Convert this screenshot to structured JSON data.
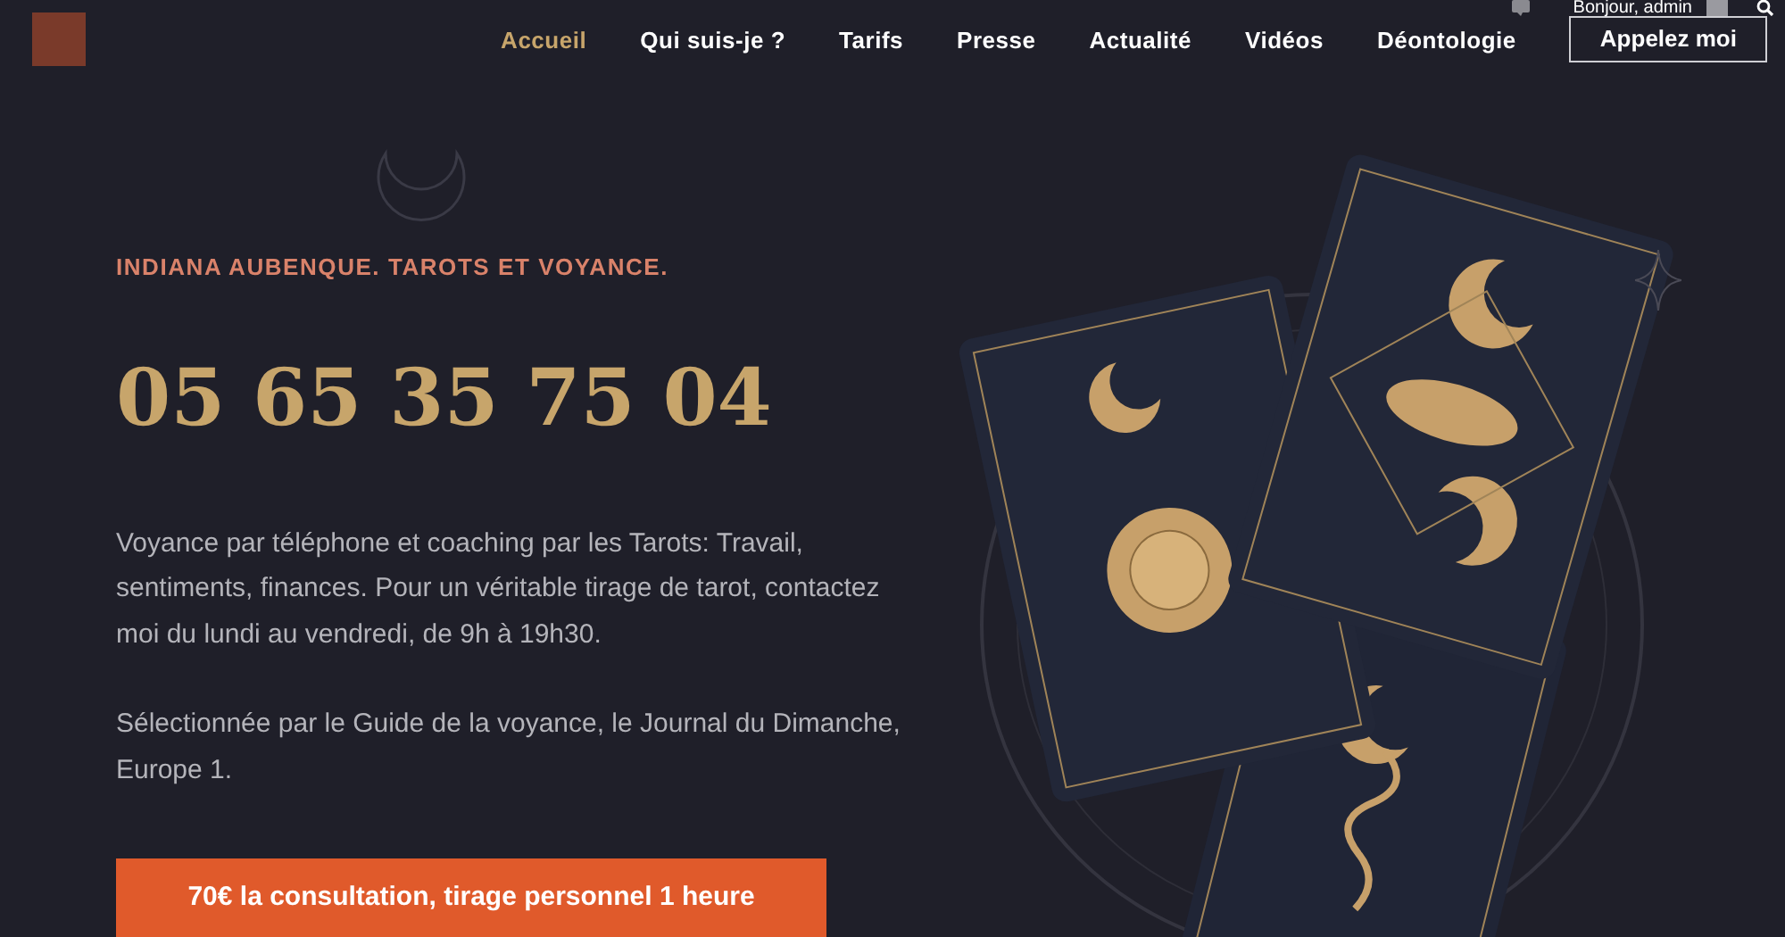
{
  "admin_bar": {
    "greeting": "Bonjour, admin"
  },
  "nav": {
    "items": [
      {
        "label": "Accueil",
        "selected": true
      },
      {
        "label": "Qui suis-je ?",
        "selected": false
      },
      {
        "label": "Tarifs",
        "selected": false
      },
      {
        "label": "Presse",
        "selected": false
      },
      {
        "label": "Actualité",
        "selected": false
      },
      {
        "label": "Vidéos",
        "selected": false
      },
      {
        "label": "Déontologie",
        "selected": false
      }
    ],
    "cta": "Appelez moi"
  },
  "hero": {
    "tagline": "INDIANA AUBENQUE. TAROTS ET VOYANCE.",
    "phone": "05 65 35 75 04",
    "paragraphs": [
      "Voyance par téléphone et coaching par les Tarots: Travail, sentiments, finances. Pour un véritable tirage de tarot, contactez moi du lundi au vendredi, de 9h à 19h30.",
      "Sélectionnée par le Guide de la voyance, le Journal du Dimanche, Europe 1."
    ],
    "button": "70€ la consultation, tirage personnel 1 heure"
  }
}
